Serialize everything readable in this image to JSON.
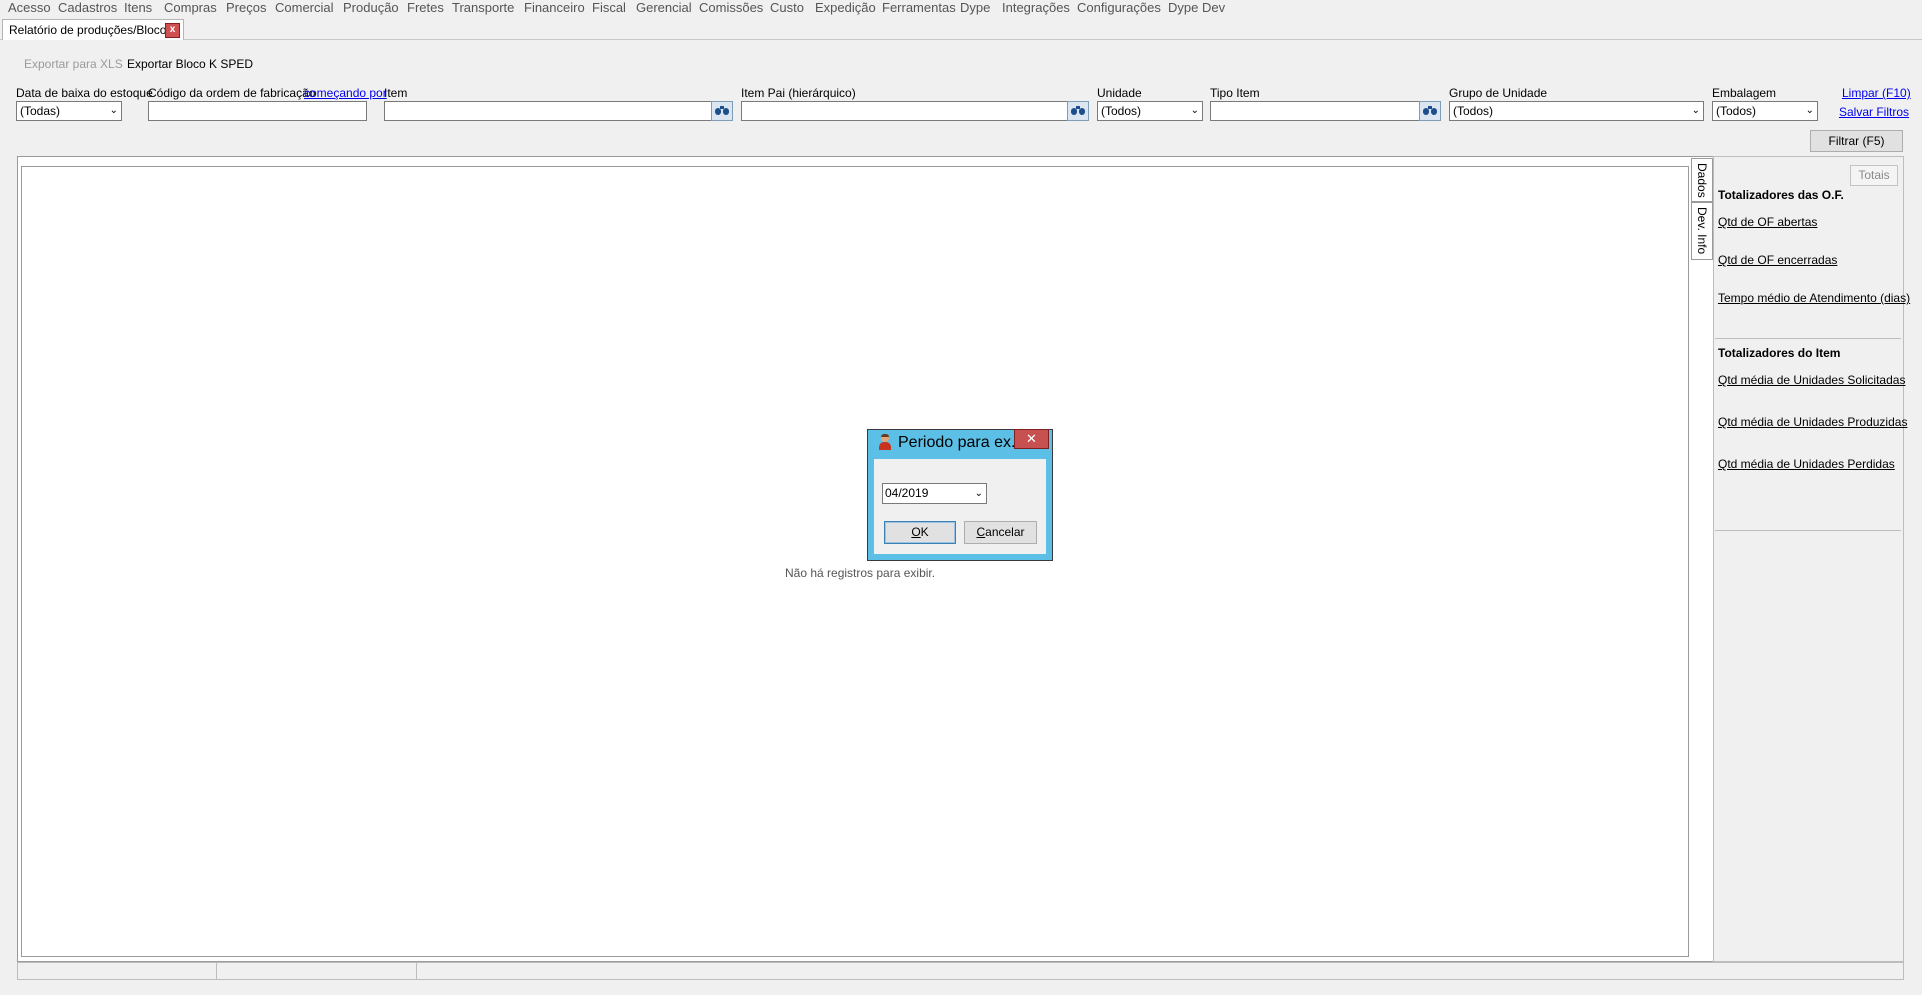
{
  "menu": [
    "Acesso",
    "Cadastros",
    "Itens",
    "Compras",
    "Preços",
    "Comercial",
    "Produção",
    "Fretes",
    "Transporte",
    "Financeiro",
    "Fiscal",
    "Gerencial",
    "Comissões",
    "Custo",
    "Expedição",
    "Ferramentas",
    "Dype",
    "Integrações",
    "Configurações",
    "Dype Dev"
  ],
  "tab": {
    "label": "Relatório de produções/Bloco k",
    "close": "x"
  },
  "toolbar": {
    "export_xls": "Exportar para XLS",
    "export_sped": "Exportar Bloco K SPED"
  },
  "filters": {
    "data_baixa": {
      "label": "Data de baixa do estoque",
      "value": "(Todas)"
    },
    "codigo_of": {
      "label": "Código da ordem de fabricação",
      "link": "começando por",
      "value": ""
    },
    "item": {
      "label": "Item",
      "value": ""
    },
    "item_pai": {
      "label": "Item Pai (hierárquico)",
      "value": ""
    },
    "unidade": {
      "label": "Unidade",
      "value": "(Todos)"
    },
    "tipo_item": {
      "label": "Tipo Item",
      "value": ""
    },
    "grupo_unidade": {
      "label": "Grupo de Unidade",
      "value": "(Todos)"
    },
    "embalagem": {
      "label": "Embalagem",
      "value": "(Todos)"
    },
    "limpar": "Limpar (F10)",
    "salvar": "Salvar Filtros",
    "filtrar": "Filtrar (F5)"
  },
  "grid": {
    "empty_message": "Não há registros para exibir."
  },
  "side_tabs": [
    "Dados",
    "Dev. Info"
  ],
  "totals_panel": {
    "button": "Totais",
    "of_heading": "Totalizadores das O.F.",
    "of_items": [
      "Qtd de OF abertas",
      "Qtd de OF encerradas",
      "Tempo médio de Atendimento (dias)"
    ],
    "item_heading": "Totalizadores do Item",
    "item_items": [
      "Qtd média de Unidades Solicitadas",
      "Qtd média de Unidades Produzidas",
      "Qtd média de Unidades Perdidas"
    ]
  },
  "dialog": {
    "title": "Periodo para ex...",
    "close": "✕",
    "period_value": "04/2019",
    "ok": {
      "pre": "",
      "key": "O",
      "post": "K"
    },
    "cancel": {
      "pre": "",
      "key": "C",
      "post": "ancelar"
    }
  },
  "icons": {
    "lookup": "binoculars-icon",
    "dialog": "user-icon",
    "dropdown": "chevron-down-icon"
  }
}
